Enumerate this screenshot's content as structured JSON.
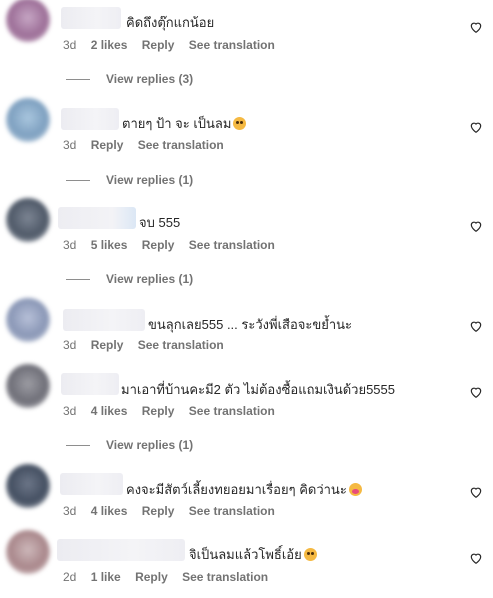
{
  "ui": {
    "reply_label": "Reply",
    "see_translation_label": "See translation"
  },
  "comments": [
    {
      "text": "คิดถึงตุ๊กแกน้อย",
      "emoji": "",
      "age": "3d",
      "likes": "2 likes",
      "view_replies": "View replies (3)",
      "avatar_color": "#b58fb0"
    },
    {
      "text": "ตายๆ ป้า จะ เป็นลม",
      "emoji": "flushed-face",
      "age": "3d",
      "likes": "",
      "view_replies": "View replies (1)",
      "avatar_color": "#8fb2cf"
    },
    {
      "text": "จบ 555",
      "emoji": "",
      "age": "3d",
      "likes": "5 likes",
      "view_replies": "View replies (1)",
      "avatar_color": "#6c7787"
    },
    {
      "text": "ขนลุกเลย555 ... ระวังพี่เสือจะขย้ำนะ",
      "emoji": "",
      "age": "3d",
      "likes": "",
      "view_replies": "",
      "avatar_color": "#a0adc9"
    },
    {
      "text": "มาเอาที่บ้านคะมี2 ตัว ไม่ต้องซื้อแถมเงินด้วย5555",
      "emoji": "",
      "age": "3d",
      "likes": "4 likes",
      "view_replies": "View replies (1)",
      "avatar_color": "#8a8a92"
    },
    {
      "text": "คงจะมีสัตว์เลี้ยงทยอยมาเรื่อยๆ คิดว่านะ",
      "emoji": "kissing-face",
      "age": "3d",
      "likes": "4 likes",
      "view_replies": "",
      "avatar_color": "#5d6778"
    },
    {
      "text": "จิเป็นลมแล้วโพธิ์เอ้ย",
      "emoji": "flushed-face",
      "age": "2d",
      "likes": "1 like",
      "view_replies": "",
      "avatar_color": "#c4aeb0"
    }
  ],
  "icons": {
    "like": "heart-outline-icon"
  }
}
